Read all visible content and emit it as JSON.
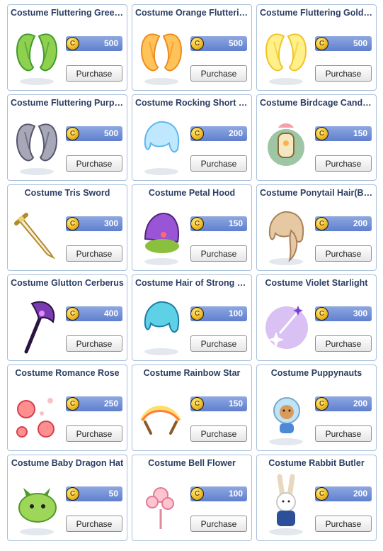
{
  "shop": {
    "coin_symbol": "C",
    "items": [
      {
        "name": "Costume Fluttering Green ...",
        "price": "500",
        "button": "Purchase",
        "icon": "green-wings-icon",
        "colors": [
          "#8fd14f",
          "#3f9b2e"
        ]
      },
      {
        "name": "Costume Orange Fluttering ...",
        "price": "500",
        "button": "Purchase",
        "icon": "orange-wings-icon",
        "colors": [
          "#ffc35a",
          "#f08a1c"
        ]
      },
      {
        "name": "Costume Fluttering Gold Wi...",
        "price": "500",
        "button": "Purchase",
        "icon": "gold-wings-icon",
        "colors": [
          "#fff08a",
          "#f2c326"
        ]
      },
      {
        "name": "Costume Fluttering Purple ...",
        "price": "500",
        "button": "Purchase",
        "icon": "purple-wings-icon",
        "colors": [
          "#a7a7b8",
          "#55556e"
        ]
      },
      {
        "name": "Costume Rocking Short (Lig...",
        "price": "200",
        "button": "Purchase",
        "icon": "light-blue-hair-icon",
        "colors": [
          "#bfe8ff",
          "#5db8ee"
        ]
      },
      {
        "name": "Costume Birdcage Candle H...",
        "price": "150",
        "button": "Purchase",
        "icon": "birdcage-candle-icon",
        "colors": [
          "#f4a0a8",
          "#3e8e4a"
        ]
      },
      {
        "name": "Costume Tris Sword",
        "price": "300",
        "button": "Purchase",
        "icon": "sword-icon",
        "colors": [
          "#e8d27a",
          "#b58a2a"
        ]
      },
      {
        "name": "Costume Petal Hood",
        "price": "150",
        "button": "Purchase",
        "icon": "petal-hood-icon",
        "colors": [
          "#9a55d6",
          "#8bbf3e"
        ]
      },
      {
        "name": "Costume Ponytail Hair(Brow...",
        "price": "200",
        "button": "Purchase",
        "icon": "ponytail-hair-icon",
        "colors": [
          "#e6c9a3",
          "#a8825b"
        ]
      },
      {
        "name": "Costume Glutton Cerberus",
        "price": "400",
        "button": "Purchase",
        "icon": "cerberus-staff-icon",
        "colors": [
          "#7b3bb0",
          "#2a1440"
        ]
      },
      {
        "name": "Costume Hair of Strong (Blue)",
        "price": "100",
        "button": "Purchase",
        "icon": "blue-hair-icon",
        "colors": [
          "#5fd1e6",
          "#1d7fa8"
        ]
      },
      {
        "name": "Costume Violet Starlight",
        "price": "300",
        "button": "Purchase",
        "icon": "violet-starlight-icon",
        "colors": [
          "#c9a6f0",
          "#7a3fd0"
        ]
      },
      {
        "name": "Costume Romance Rose",
        "price": "250",
        "button": "Purchase",
        "icon": "rose-icon",
        "colors": [
          "#ff8f8f",
          "#d63f4f"
        ]
      },
      {
        "name": "Costume Rainbow Star",
        "price": "150",
        "button": "Purchase",
        "icon": "rainbow-star-icon",
        "colors": [
          "#ffe066",
          "#ff7a3d"
        ]
      },
      {
        "name": "Costume Puppynauts",
        "price": "200",
        "button": "Purchase",
        "icon": "puppynaut-icon",
        "colors": [
          "#bfe3f7",
          "#d99a5a"
        ]
      },
      {
        "name": "Costume Baby Dragon Hat",
        "price": "50",
        "button": "Purchase",
        "icon": "baby-dragon-icon",
        "colors": [
          "#9ed65a",
          "#4f9a2a"
        ]
      },
      {
        "name": "Costume Bell Flower",
        "price": "100",
        "button": "Purchase",
        "icon": "bell-flower-icon",
        "colors": [
          "#ffc4d0",
          "#e07a96"
        ]
      },
      {
        "name": "Costume Rabbit Butler",
        "price": "200",
        "button": "Purchase",
        "icon": "rabbit-butler-icon",
        "colors": [
          "#ffffff",
          "#2d4f9a"
        ]
      }
    ]
  }
}
